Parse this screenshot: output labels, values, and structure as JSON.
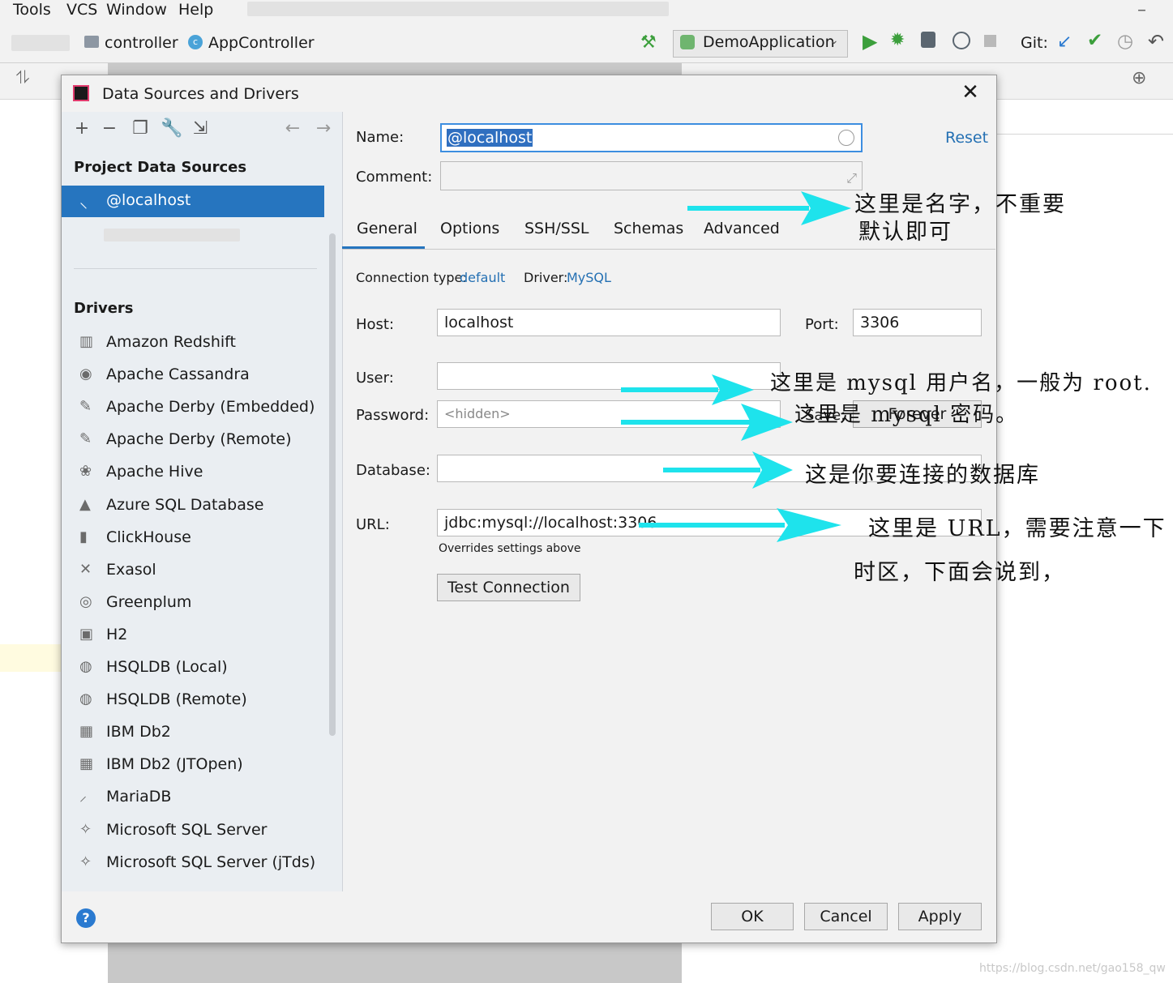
{
  "menubar": {
    "items": [
      "Tools",
      "VCS",
      "Window",
      "Help"
    ]
  },
  "navbar": {
    "breadcrumb": [
      "controller",
      "AppController"
    ],
    "run_config": "DemoApplication",
    "git_label": "Git:"
  },
  "dialog": {
    "title": "Data Sources and Drivers",
    "left": {
      "project_header": "Project Data Sources",
      "selected_source": "@localhost",
      "drivers_header": "Drivers",
      "drivers": [
        {
          "label": "Amazon Redshift",
          "icon": "redshift-icon"
        },
        {
          "label": "Apache Cassandra",
          "icon": "cassandra-icon"
        },
        {
          "label": "Apache Derby (Embedded)",
          "icon": "derby-icon"
        },
        {
          "label": "Apache Derby (Remote)",
          "icon": "derby-icon"
        },
        {
          "label": "Apache Hive",
          "icon": "hive-icon"
        },
        {
          "label": "Azure SQL Database",
          "icon": "azure-icon"
        },
        {
          "label": "ClickHouse",
          "icon": "clickhouse-icon"
        },
        {
          "label": "Exasol",
          "icon": "exasol-icon"
        },
        {
          "label": "Greenplum",
          "icon": "greenplum-icon"
        },
        {
          "label": "H2",
          "icon": "h2-icon"
        },
        {
          "label": "HSQLDB (Local)",
          "icon": "hsqldb-icon"
        },
        {
          "label": "HSQLDB (Remote)",
          "icon": "hsqldb-icon"
        },
        {
          "label": "IBM Db2",
          "icon": "db2-icon"
        },
        {
          "label": "IBM Db2 (JTOpen)",
          "icon": "db2-icon"
        },
        {
          "label": "MariaDB",
          "icon": "mariadb-icon"
        },
        {
          "label": "Microsoft SQL Server",
          "icon": "mssql-icon"
        },
        {
          "label": "Microsoft SQL Server (jTds)",
          "icon": "mssql-icon"
        }
      ]
    },
    "form": {
      "name_label": "Name:",
      "name_value": "@localhost",
      "reset_label": "Reset",
      "comment_label": "Comment:",
      "tabs": [
        "General",
        "Options",
        "SSH/SSL",
        "Schemas",
        "Advanced"
      ],
      "conn_type_label": "Connection type:",
      "conn_type_value": "default",
      "driver_label": "Driver:",
      "driver_value": "MySQL",
      "host_label": "Host:",
      "host_value": "localhost",
      "port_label": "Port:",
      "port_value": "3306",
      "user_label": "User:",
      "password_label": "Password:",
      "password_placeholder": "<hidden>",
      "save_label": "Save:",
      "save_value": "Forever",
      "database_label": "Database:",
      "url_label": "URL:",
      "url_value": "jdbc:mysql://localhost:3306",
      "url_note": "Overrides settings above",
      "test_button": "Test Connection"
    },
    "buttons": {
      "ok": "OK",
      "cancel": "Cancel",
      "apply": "Apply"
    }
  },
  "annotations": {
    "name_line1": "这里是名字，不重要",
    "name_line2": "默认即可",
    "user": "这里是 mysql 用户名，一般为 root.",
    "password": "这里是 mysql 密码。",
    "database": "这是你要连接的数据库",
    "url_line1": "这里是 URL，需要注意一下",
    "url_line2": "时区，下面会说到，"
  },
  "watermark": "https://blog.csdn.net/gao158_qw",
  "colors": {
    "accent": "#2675bf",
    "arrow": "#1ee3ec",
    "link": "#2470b3",
    "run": "#3c9f3c"
  }
}
